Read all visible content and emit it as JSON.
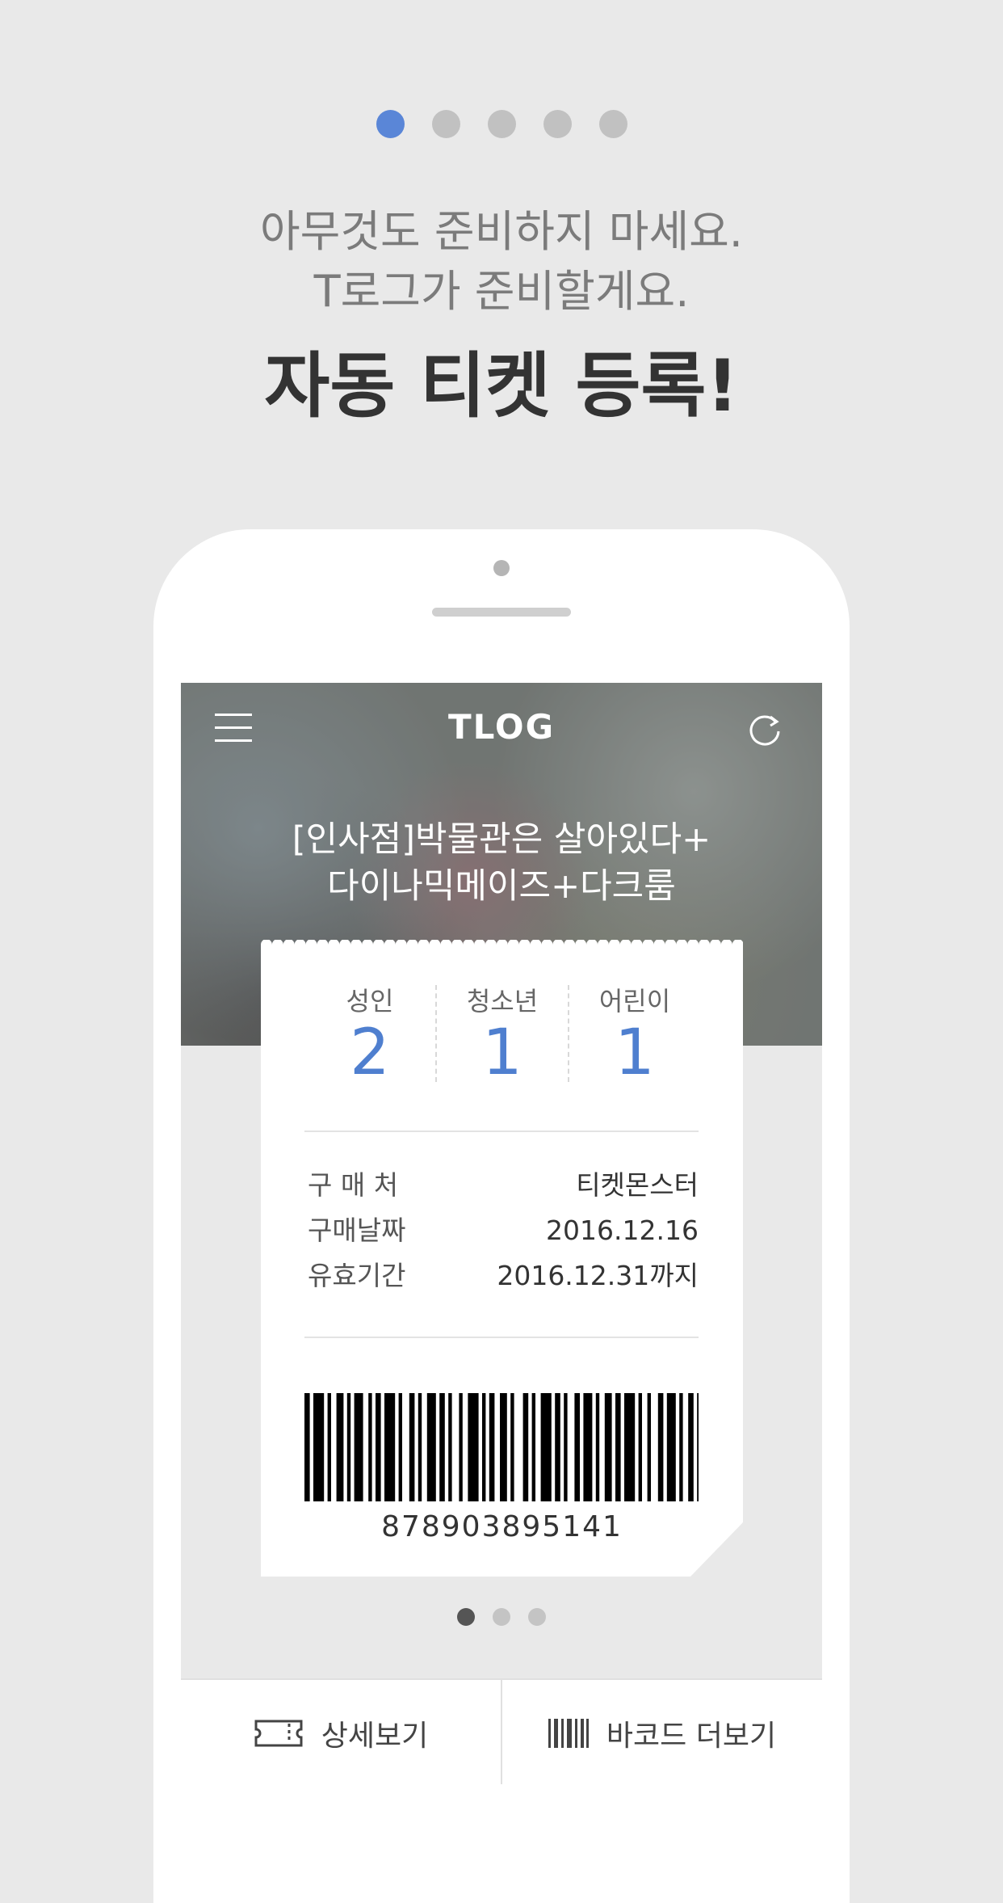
{
  "pager": {
    "count": 5,
    "active": 0
  },
  "headline": {
    "line1": "아무것도 준비하지 마세요.",
    "line2": "T로그가 준비할게요.",
    "title": "자동 티켓 등록!"
  },
  "app": {
    "title": "TLOG",
    "event_line1": "[인사점]박물관은 살아있다+",
    "event_line2": "다이나믹메이즈+다크룸"
  },
  "ticket": {
    "counts": [
      {
        "label": "성인",
        "value": "2"
      },
      {
        "label": "청소년",
        "value": "1"
      },
      {
        "label": "어린이",
        "value": "1"
      }
    ],
    "info": [
      {
        "label": "구 매 처",
        "value": "티켓몬스터"
      },
      {
        "label": "구매날짜",
        "value": "2016.12.16"
      },
      {
        "label": "유효기간",
        "value": "2016.12.31까지"
      }
    ],
    "barcode_number": "878903895141"
  },
  "carousel": {
    "count": 3,
    "active": 0
  },
  "actions": {
    "detail_label": "상세보기",
    "barcode_label": "바코드 더보기"
  },
  "colors": {
    "accent": "#4f7fcf",
    "pager_active": "#5a86d7"
  }
}
